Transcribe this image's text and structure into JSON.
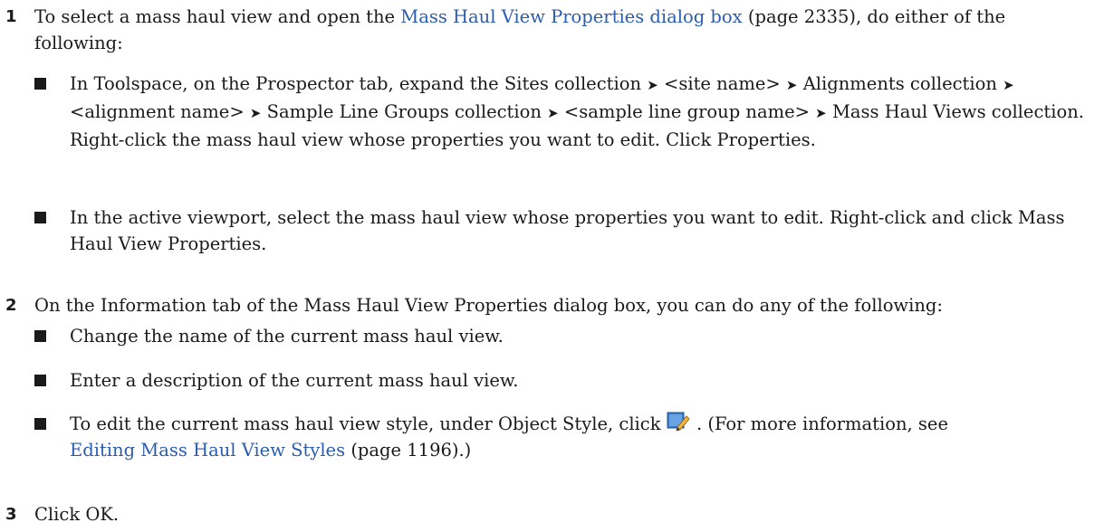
{
  "steps": [
    {
      "number": "1",
      "text_before": "To select a mass haul view and open the",
      "link": "Mass Haul View Properties dialog box",
      "text_after": "(page 2335), do either of the following:",
      "bullets": [
        {
          "seg1": "In Toolspace, on the Prospector tab, expand the Sites collection",
          "seg2": "<site name>",
          "seg3": "Alignments collection",
          "seg4": "<alignment name>",
          "seg5": "Sample Line Groups collection",
          "seg6": "<sample line group name>",
          "seg7": "Mass Haul Views collection. Right-click the mass haul view whose properties you want to edit. Click Properties."
        },
        {
          "text": "In the active viewport, select the mass haul view whose properties you want to edit. Right-click and click Mass Haul View Properties."
        }
      ]
    },
    {
      "number": "2",
      "text": "On the Information tab of the Mass Haul View Properties dialog box, you can do any of the following:",
      "bullets": [
        {
          "text": "Change the name of the current mass haul view."
        },
        {
          "text": "Enter a description of the current mass haul view."
        },
        {
          "text_before": "To edit the current mass haul view style, under Object Style, click",
          "icon": "edit-style-icon",
          "text_after": ". (For more information, see",
          "link": "Editing Mass Haul View Styles",
          "text_end": "(page 1196).)"
        }
      ]
    },
    {
      "number": "3",
      "text": "Click OK."
    }
  ],
  "arrow_glyph": "➤",
  "colors": {
    "link": "#2a5db0",
    "text": "#1a1a1a"
  }
}
